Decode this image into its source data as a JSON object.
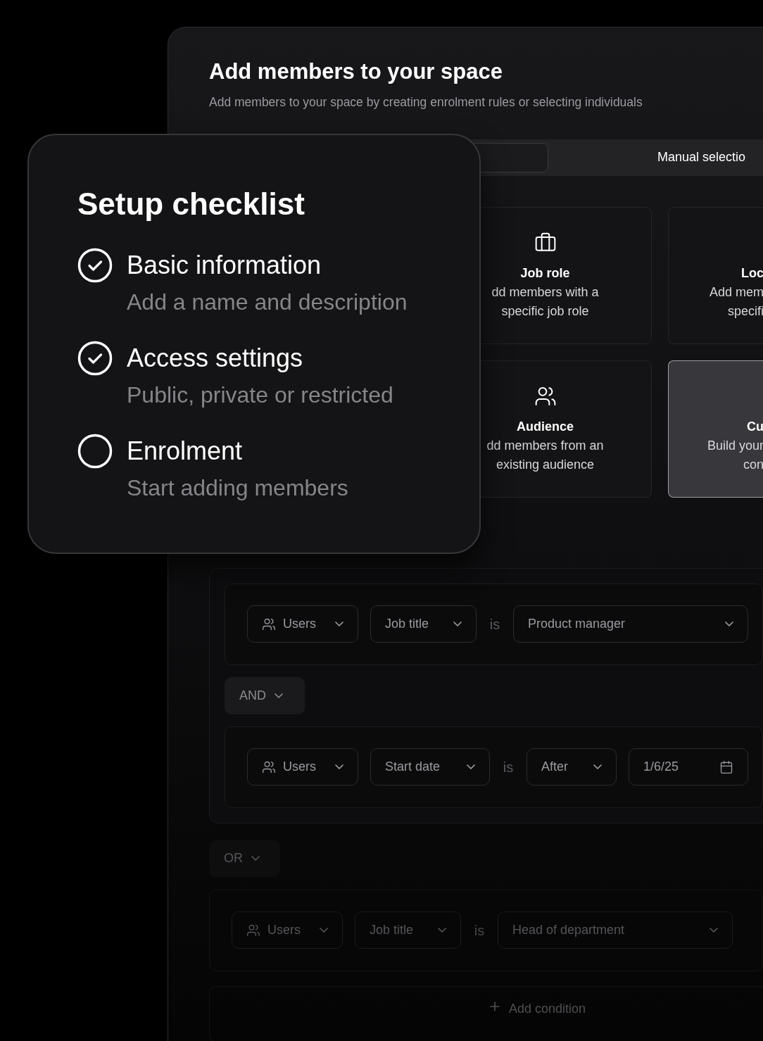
{
  "window": {
    "title": "Add members to your space",
    "subtitle": "Add members to your space by creating enrolment rules or selecting individuals"
  },
  "tabs": [
    {
      "selected": true
    },
    {
      "label": "Manual selectio",
      "selected": false
    }
  ],
  "options": [
    {
      "title": "Job role",
      "lines": [
        "dd members with a",
        "specific job role"
      ],
      "selected": false
    },
    {
      "title": "Loc",
      "lines": [
        "Add mem",
        "specifi"
      ],
      "selected": false
    },
    {
      "title": "Audience",
      "lines": [
        "dd members from an",
        "existing audience"
      ],
      "selected": false
    },
    {
      "title": "Cu",
      "lines": [
        "Build your",
        "con"
      ],
      "selected": true
    }
  ],
  "rule_group": {
    "rules": [
      {
        "subject": "Users",
        "field": "Job title",
        "operator": "is",
        "value": {
          "kind": "select",
          "text": "Product manager"
        }
      },
      {
        "subject": "Users",
        "field": "Start date",
        "operator": "is",
        "comparison": "After",
        "value": {
          "kind": "date",
          "text": "1/6/25"
        }
      }
    ],
    "connector": "AND"
  },
  "group_connector": "OR",
  "second_group": {
    "rules": [
      {
        "subject": "Users",
        "field": "Job title",
        "operator": "is",
        "value": {
          "kind": "select",
          "text": "Head of department"
        }
      }
    ],
    "add_condition": "Add condition"
  },
  "checklist": {
    "title": "Setup checklist",
    "items": [
      {
        "title": "Basic information",
        "description": "Add a name and description",
        "checked": true
      },
      {
        "title": "Access settings",
        "description": "Public, private or restricted",
        "checked": true
      },
      {
        "title": "Enrolment",
        "description": "Start adding members",
        "checked": false
      }
    ]
  }
}
